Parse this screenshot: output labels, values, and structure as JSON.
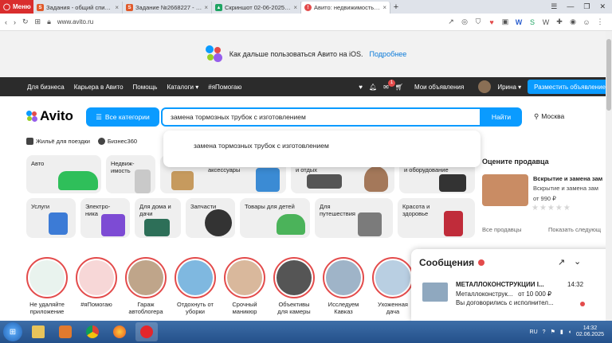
{
  "browser": {
    "menu_label": "Меню",
    "tabs": [
      {
        "title": "Задания - общий список ...",
        "icon": "sp-icon",
        "color": "#e05a2b",
        "glyph": "SP"
      },
      {
        "title": "Задание №2668227 - про...",
        "icon": "sp-icon",
        "color": "#e05a2b",
        "glyph": "SP"
      },
      {
        "title": "Скриншот 02-06-2025 130...",
        "icon": "drive-icon",
        "color": "#1fa463",
        "glyph": "▲"
      },
      {
        "title": "Авито: недвижимость, тра...",
        "icon": "avito-icon",
        "color": "#e34b4b",
        "glyph": "!"
      }
    ],
    "url": "www.avito.ru"
  },
  "banner": {
    "text": "Как дальше пользоваться Авито на iOS.",
    "link": "Подробнее"
  },
  "topnav": {
    "links": [
      "Для бизнеса",
      "Карьера в Авито",
      "Помощь",
      "Каталоги ▾",
      "#яПомогаю"
    ],
    "notification_count": "1",
    "my_ads": "Мои объявления",
    "user": "Ирина ▾",
    "post_button": "Разместить объявление"
  },
  "header": {
    "logo": "Avito",
    "categories_button": "Все категории",
    "search_value": "замена тормозных трубок с изготовлением",
    "find_button": "Найти",
    "city": "Москва",
    "suggestion": "замена тормозных трубок с изготовлением"
  },
  "quick_links": [
    {
      "label": "Жильё для поездки"
    },
    {
      "label": "Бизнес360"
    }
  ],
  "categories_row1": [
    "Авто",
    "Недвиж-\nимость",
    "",
    "Аксессуары",
    "Хобби\nи отдых",
    "",
    "Электроника\nи оборудование",
    ""
  ],
  "categories_row1_visible": [
    {
      "label": "Авто"
    },
    {
      "label": "Недвиж-имость"
    },
    {
      "label": "аксессуары"
    },
    {
      "label": "и отдых"
    },
    {
      "label": "и оборудование"
    }
  ],
  "categories_row2": [
    {
      "label": "Услуги"
    },
    {
      "label": "Электро-ника"
    },
    {
      "label": "Для дома и дачи"
    },
    {
      "label": "Запчасти"
    },
    {
      "label": "Товары для детей"
    },
    {
      "label": "Для путешествия"
    },
    {
      "label": "Красота и здоровье"
    }
  ],
  "seller": {
    "heading": "Оцените продавца",
    "title": "Вскрытие и замена зам",
    "subtitle": "Вскрытие и замена зам",
    "price": "от 990 ₽",
    "stars": "★★★★★",
    "all_sellers": "Все продавцы",
    "show_more": "Показать следующ"
  },
  "stories": [
    {
      "label": "Не удаляйте приложение",
      "color": "#e9f3ee"
    },
    {
      "label": "#яПомогаю",
      "color": "#f7d7d7"
    },
    {
      "label": "Гараж автоблогера",
      "color": "#bfa58a"
    },
    {
      "label": "Отдохнуть от уборки",
      "color": "#7fb8e0"
    },
    {
      "label": "Срочный маникюр",
      "color": "#d9b89c"
    },
    {
      "label": "Объективы для камеры",
      "color": "#555555"
    },
    {
      "label": "Исследуем Кавказ",
      "color": "#9fb4c8"
    },
    {
      "label": "Ухоженная дача",
      "color": "#b9cfe2"
    }
  ],
  "messenger": {
    "title": "Сообщения",
    "item": {
      "name": "МЕТАЛЛОКОНСТРУКЦИИ І...",
      "time": "14:32",
      "line2": "Металлоконструк...   от 10 000 ₽",
      "line3": "Вы договорились с исполнител..."
    }
  },
  "taskbar": {
    "lang": "RU",
    "time": "14:32",
    "date": "02.06.2025"
  },
  "colors": {
    "accent": "#0a9bff",
    "avito_red": "#e34b4b",
    "nav_dark": "#2b2b2b"
  }
}
